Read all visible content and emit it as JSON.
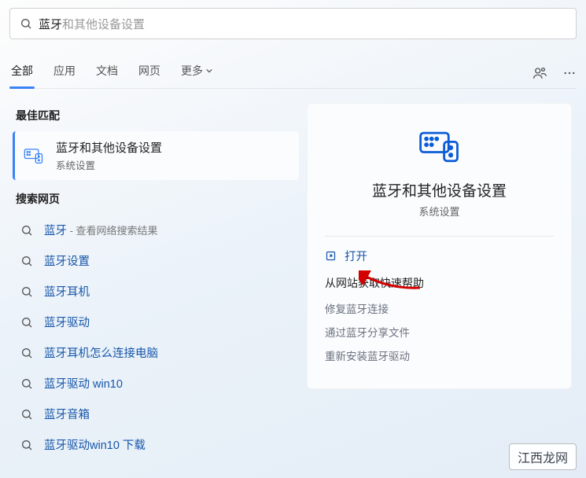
{
  "search": {
    "typed": "蓝牙",
    "completion": "和其他设备设置"
  },
  "tabs": {
    "items": [
      "全部",
      "应用",
      "文档",
      "网页",
      "更多"
    ],
    "active_index": 0
  },
  "sections": {
    "best_match_label": "最佳匹配",
    "web_label": "搜索网页"
  },
  "best_match": {
    "title": "蓝牙和其他设备设置",
    "subtitle": "系统设置"
  },
  "web_results": [
    {
      "label": "蓝牙",
      "hint": " - 查看网络搜索结果"
    },
    {
      "label": "蓝牙设置",
      "hint": ""
    },
    {
      "label": "蓝牙耳机",
      "hint": ""
    },
    {
      "label": "蓝牙驱动",
      "hint": ""
    },
    {
      "label": "蓝牙耳机怎么连接电脑",
      "hint": ""
    },
    {
      "label": "蓝牙驱动 win10",
      "hint": ""
    },
    {
      "label": "蓝牙音箱",
      "hint": ""
    },
    {
      "label": "蓝牙驱动win10 下载",
      "hint": ""
    }
  ],
  "preview": {
    "title": "蓝牙和其他设备设置",
    "subtitle": "系统设置",
    "open_label": "打开",
    "quick_help_label": "从网站获取快速帮助",
    "help_links": [
      "修复蓝牙连接",
      "通过蓝牙分享文件",
      "重新安装蓝牙驱动"
    ]
  },
  "watermark": "江西龙网"
}
